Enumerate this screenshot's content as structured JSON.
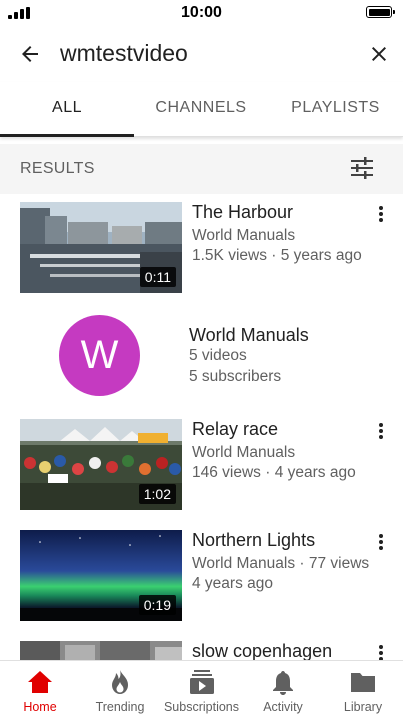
{
  "status_bar": {
    "time": "10:00"
  },
  "search": {
    "query": "wmtestvideo"
  },
  "tabs": [
    {
      "label": "ALL",
      "active": true
    },
    {
      "label": "CHANNELS",
      "active": false
    },
    {
      "label": "PLAYLISTS",
      "active": false
    }
  ],
  "results": {
    "label": "RESULTS",
    "videos": [
      {
        "title": "The Harbour",
        "meta_line1": "World Manuals",
        "meta_line2": "1.5K views · 5 years ago",
        "duration": "0:11"
      },
      {
        "title": "Relay race",
        "meta_line1": "World Manuals",
        "meta_line2": "146 views · 4 years ago",
        "duration": "1:02"
      },
      {
        "title": "Northern Lights",
        "meta_line1": "World Manuals · 77 views",
        "meta_line2": "4 years ago",
        "duration": "0:19"
      },
      {
        "title": "slow copenhagen"
      }
    ],
    "channel": {
      "initial": "W",
      "name": "World Manuals",
      "videos": "5 videos",
      "subscribers": "5 subscribers",
      "avatar_color": "#c53ac1"
    }
  },
  "bottom_nav": [
    {
      "label": "Home",
      "icon": "home-icon",
      "active": true
    },
    {
      "label": "Trending",
      "icon": "flame-icon",
      "active": false
    },
    {
      "label": "Subscriptions",
      "icon": "subscriptions-icon",
      "active": false
    },
    {
      "label": "Activity",
      "icon": "bell-icon",
      "active": false
    },
    {
      "label": "Library",
      "icon": "folder-icon",
      "active": false
    }
  ],
  "colors": {
    "accent": "#e00000",
    "text": "#212121",
    "secondary_text": "#606060"
  }
}
